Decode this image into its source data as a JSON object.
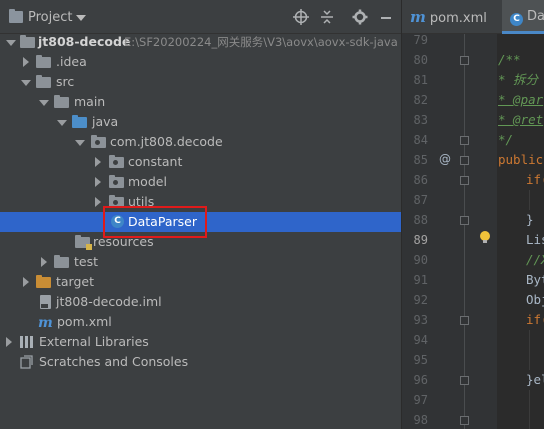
{
  "project_panel": {
    "title": "Project",
    "header_icons": [
      "crosshair-icon",
      "collapse-icon",
      "gear-icon",
      "minimize-icon"
    ]
  },
  "tree": {
    "root": {
      "label": "jt808-decode",
      "path": "E:\\SF20200224_网关服务\\V3\\aovx\\aovx-sdk-java"
    },
    "idea": ".idea",
    "src": "src",
    "main": "main",
    "java": "java",
    "package": "com.jt808.decode",
    "constant": "constant",
    "model": "model",
    "utils": "utils",
    "dataparser": "DataParser",
    "resources": "resources",
    "test": "test",
    "target": "target",
    "iml": "jt808-decode.iml",
    "pom": "pom.xml",
    "external_libraries": "External Libraries",
    "scratches": "Scratches and Consoles"
  },
  "editor": {
    "tabs": [
      {
        "label": "pom.xml"
      },
      {
        "label": "Da"
      }
    ],
    "line_numbers": [
      "79",
      "80",
      "81",
      "82",
      "83",
      "84",
      "85",
      "86",
      "87",
      "88",
      "89",
      "90",
      "91",
      "92",
      "93",
      "94",
      "95",
      "96",
      "97",
      "98"
    ],
    "current_line": "89",
    "code": {
      "l80": "/**",
      "l81": " * 拆分",
      "l82": " * @par",
      "l83": " * @ret",
      "l84": " */",
      "l85": "public",
      "l86": "if(",
      "l88": "}",
      "l89": "Lis",
      "l90": "//X",
      "l91": "Byt",
      "l92": "Obj",
      "l93": "if(",
      "l96": "}el"
    }
  },
  "colors": {
    "panel_bg": "#3c3f41",
    "editor_bg": "#2b2b2b",
    "selection": "#2f65ca",
    "highlight_border": "#e01a1a",
    "comment": "#629755",
    "keyword": "#cc7832"
  }
}
